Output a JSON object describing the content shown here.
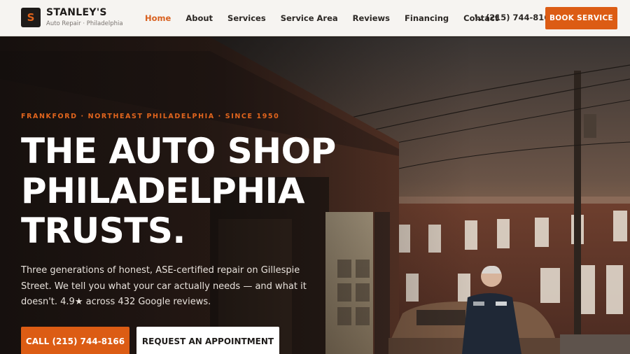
{
  "brand": {
    "mark": "S",
    "name": "STANLEY'S",
    "tagline": "Auto Repair · Philadelphia"
  },
  "nav": {
    "items": [
      {
        "label": "Home",
        "active": true
      },
      {
        "label": "About",
        "active": false
      },
      {
        "label": "Services",
        "active": false
      },
      {
        "label": "Service Area",
        "active": false
      },
      {
        "label": "Reviews",
        "active": false
      },
      {
        "label": "Financing",
        "active": false
      },
      {
        "label": "Contact",
        "active": false
      }
    ]
  },
  "header": {
    "phone": "(215) 744-8166",
    "phone_icon": "phone-icon",
    "book_label": "BOOK SERVICE"
  },
  "hero": {
    "eyebrow": "FRANKFORD · NORTHEAST PHILADELPHIA · SINCE 1950",
    "headline_lines": [
      "THE AUTO SHOP",
      "PHILADELPHIA",
      "TRUSTS."
    ],
    "lede": "Three generations of honest, ASE-certified repair on Gillespie Street. We tell you what your car actually needs — and what it doesn't. 4.9★ across 432 Google reviews.",
    "cta_primary": "CALL (215) 744-8166",
    "cta_secondary": "REQUEST AN APPOINTMENT"
  },
  "colors": {
    "accent": "#dc5c14",
    "header_bg": "#f6f4f1",
    "dark": "#1e1b19"
  }
}
